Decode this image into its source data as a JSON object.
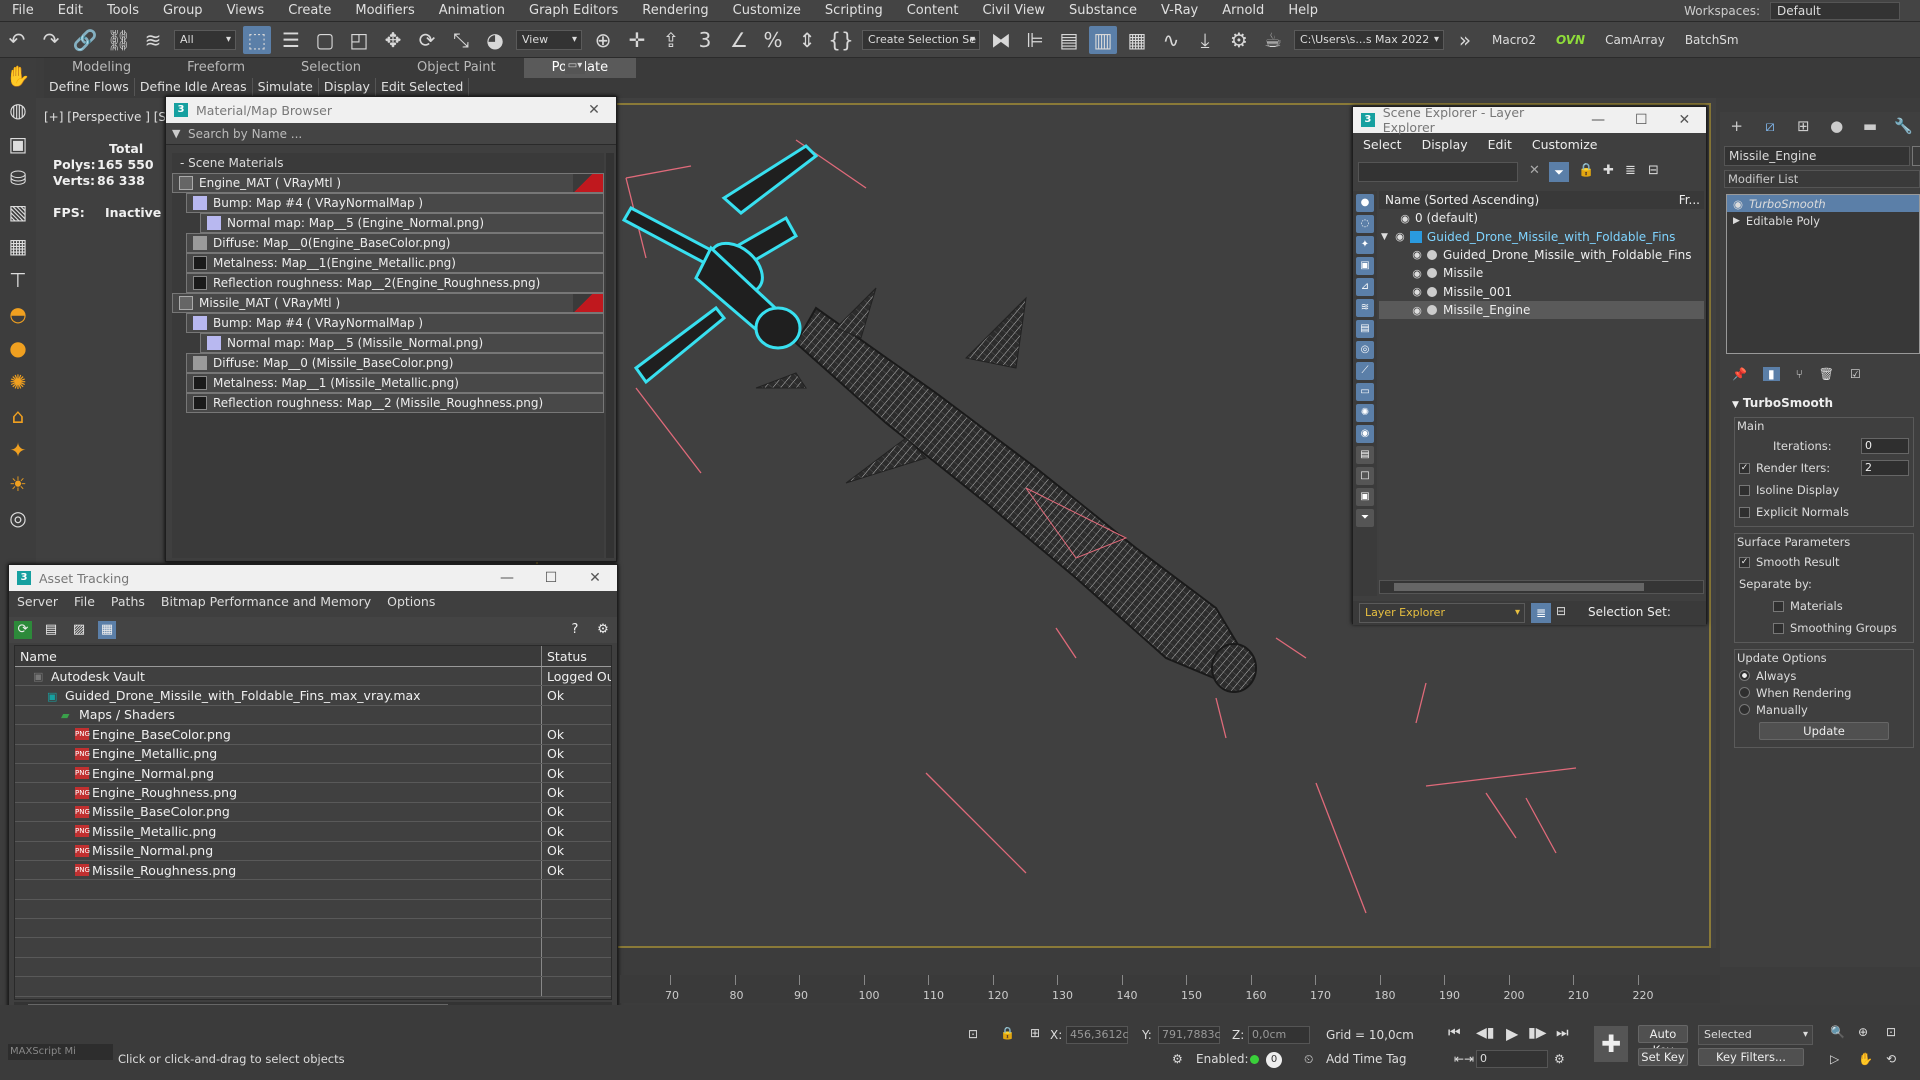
{
  "menubar": {
    "items": [
      "File",
      "Edit",
      "Tools",
      "Group",
      "Views",
      "Create",
      "Modifiers",
      "Animation",
      "Graph Editors",
      "Rendering",
      "Customize",
      "Scripting",
      "Content",
      "Civil View",
      "Substance",
      "V-Ray",
      "Arnold",
      "Help"
    ],
    "workspaces_label": "Workspaces:",
    "workspace_value": "Default"
  },
  "toolbar": {
    "filter_all": "All",
    "view_dd": "View",
    "create_selection_set": "Create Selection Se",
    "path_dd": "C:\\Users\\s...s Max 2022",
    "macro2": "Macro2",
    "ovn": "OVN",
    "camarray": "CamArray",
    "batchsm": "BatchSm"
  },
  "ribbon": {
    "tabs": [
      "Modeling",
      "Freeform",
      "Selection",
      "Object Paint",
      "Populate"
    ],
    "active": "Populate",
    "subitems": [
      "Define Flows",
      "Define Idle Areas",
      "Simulate",
      "Display",
      "Edit Selected"
    ]
  },
  "viewport": {
    "label": "[+] [Perspective ] [St",
    "stats": {
      "total": "Total",
      "polys_label": "Polys:",
      "polys": "165 550",
      "verts_label": "Verts:",
      "verts": "86 338",
      "fps_label": "FPS:",
      "fps": "Inactive"
    }
  },
  "material_browser": {
    "title": "Material/Map Browser",
    "search_placeholder": "Search by Name ...",
    "section": "- Scene Materials",
    "rows": [
      {
        "indent": 0,
        "swatch": "mat",
        "label": "Engine_MAT  ( VRayMtl )",
        "tag": true
      },
      {
        "indent": 1,
        "swatch": "lav",
        "label": "Bump: Map #4  ( VRayNormalMap )"
      },
      {
        "indent": 2,
        "swatch": "lav",
        "label": "Normal map: Map__5 (Engine_Normal.png)"
      },
      {
        "indent": 1,
        "swatch": "gry",
        "label": "Diffuse: Map__0(Engine_BaseColor.png)"
      },
      {
        "indent": 1,
        "swatch": "dark",
        "label": "Metalness: Map__1(Engine_Metallic.png)"
      },
      {
        "indent": 1,
        "swatch": "dark",
        "label": "Reflection roughness: Map__2(Engine_Roughness.png)"
      },
      {
        "indent": 0,
        "swatch": "mat",
        "label": "Missile_MAT  ( VRayMtl )",
        "tag": true
      },
      {
        "indent": 1,
        "swatch": "lav",
        "label": "Bump: Map #4  ( VRayNormalMap )"
      },
      {
        "indent": 2,
        "swatch": "lav",
        "label": "Normal map: Map__5 (Missile_Normal.png)"
      },
      {
        "indent": 1,
        "swatch": "gry",
        "label": "Diffuse: Map__0 (Missile_BaseColor.png)"
      },
      {
        "indent": 1,
        "swatch": "dark",
        "label": "Metalness: Map__1 (Missile_Metallic.png)"
      },
      {
        "indent": 1,
        "swatch": "dark",
        "label": "Reflection roughness: Map__2 (Missile_Roughness.png)"
      }
    ]
  },
  "asset_tracking": {
    "title": "Asset Tracking",
    "menu": [
      "Server",
      "File",
      "Paths",
      "Bitmap Performance and Memory",
      "Options"
    ],
    "col_name": "Name",
    "col_status": "Status",
    "rows": [
      {
        "indent": 1,
        "icon": "vault",
        "name": "Autodesk Vault",
        "status": "Logged Out"
      },
      {
        "indent": 2,
        "icon": "max",
        "name": "Guided_Drone_Missile_with_Foldable_Fins_max_vray.max",
        "status": "Ok"
      },
      {
        "indent": 3,
        "icon": "folder",
        "name": "Maps / Shaders",
        "status": ""
      },
      {
        "indent": 4,
        "icon": "png",
        "name": "Engine_BaseColor.png",
        "status": "Ok"
      },
      {
        "indent": 4,
        "icon": "png",
        "name": "Engine_Metallic.png",
        "status": "Ok"
      },
      {
        "indent": 4,
        "icon": "png",
        "name": "Engine_Normal.png",
        "status": "Ok"
      },
      {
        "indent": 4,
        "icon": "png",
        "name": "Engine_Roughness.png",
        "status": "Ok"
      },
      {
        "indent": 4,
        "icon": "png",
        "name": "Missile_BaseColor.png",
        "status": "Ok"
      },
      {
        "indent": 4,
        "icon": "png",
        "name": "Missile_Metallic.png",
        "status": "Ok"
      },
      {
        "indent": 4,
        "icon": "png",
        "name": "Missile_Normal.png",
        "status": "Ok"
      },
      {
        "indent": 4,
        "icon": "png",
        "name": "Missile_Roughness.png",
        "status": "Ok"
      }
    ],
    "empty_rows": 6
  },
  "scene_explorer": {
    "title": "Scene Explorer - Layer Explorer",
    "menu": [
      "Select",
      "Display",
      "Edit",
      "Customize"
    ],
    "col_name": "Name (Sorted Ascending)",
    "col_fr": "Fr...",
    "rows": [
      {
        "indent": 0,
        "type": "layer0",
        "name": "0 (default)"
      },
      {
        "indent": 0,
        "type": "layer",
        "name": "Guided_Drone_Missile_with_Foldable_Fins"
      },
      {
        "indent": 1,
        "type": "obj",
        "name": "Guided_Drone_Missile_with_Foldable_Fins"
      },
      {
        "indent": 1,
        "type": "obj",
        "name": "Missile"
      },
      {
        "indent": 1,
        "type": "obj",
        "name": "Missile_001"
      },
      {
        "indent": 1,
        "type": "obj",
        "name": "Missile_Engine",
        "selected": true
      }
    ],
    "footer_dd": "Layer Explorer",
    "selection_set": "Selection Set:"
  },
  "command_panel": {
    "object_name": "Missile_Engine",
    "modifier_list": "Modifier List",
    "stack": [
      {
        "name": "TurboSmooth",
        "selected": true
      },
      {
        "name": "Editable Poly",
        "selected": false
      }
    ],
    "rollout_title": "TurboSmooth",
    "main_label": "Main",
    "iterations_label": "Iterations:",
    "iterations": "0",
    "render_iters_label": "Render Iters:",
    "render_iters": "2",
    "isoline": "Isoline Display",
    "explicit_normals": "Explicit Normals",
    "surface_params": "Surface Parameters",
    "smooth_result": "Smooth Result",
    "separate_by": "Separate by:",
    "materials": "Materials",
    "smoothing_groups": "Smoothing Groups",
    "update_options": "Update Options",
    "always": "Always",
    "when_rendering": "When Rendering",
    "manually": "Manually",
    "update_btn": "Update"
  },
  "timeline": {
    "ticks": [
      "70",
      "80",
      "90",
      "100",
      "110",
      "120",
      "130",
      "140",
      "150",
      "160",
      "170",
      "180",
      "190",
      "200",
      "210",
      "220"
    ]
  },
  "status": {
    "maxscript": "MAXScript Mi",
    "prompt": "Click or click-and-drag to select objects",
    "x_label": "X:",
    "x": "456,3612c",
    "y_label": "Y:",
    "y": "791,7883c",
    "z_label": "Z:",
    "z": "0,0cm",
    "grid": "Grid = 10,0cm",
    "enabled_label": "Enabled:",
    "add_time_tag": "Add Time Tag",
    "auto_key": "Auto Key",
    "set_key": "Set Key",
    "selected_dd": "Selected",
    "key_filters": "Key Filters...",
    "frame": "0"
  }
}
